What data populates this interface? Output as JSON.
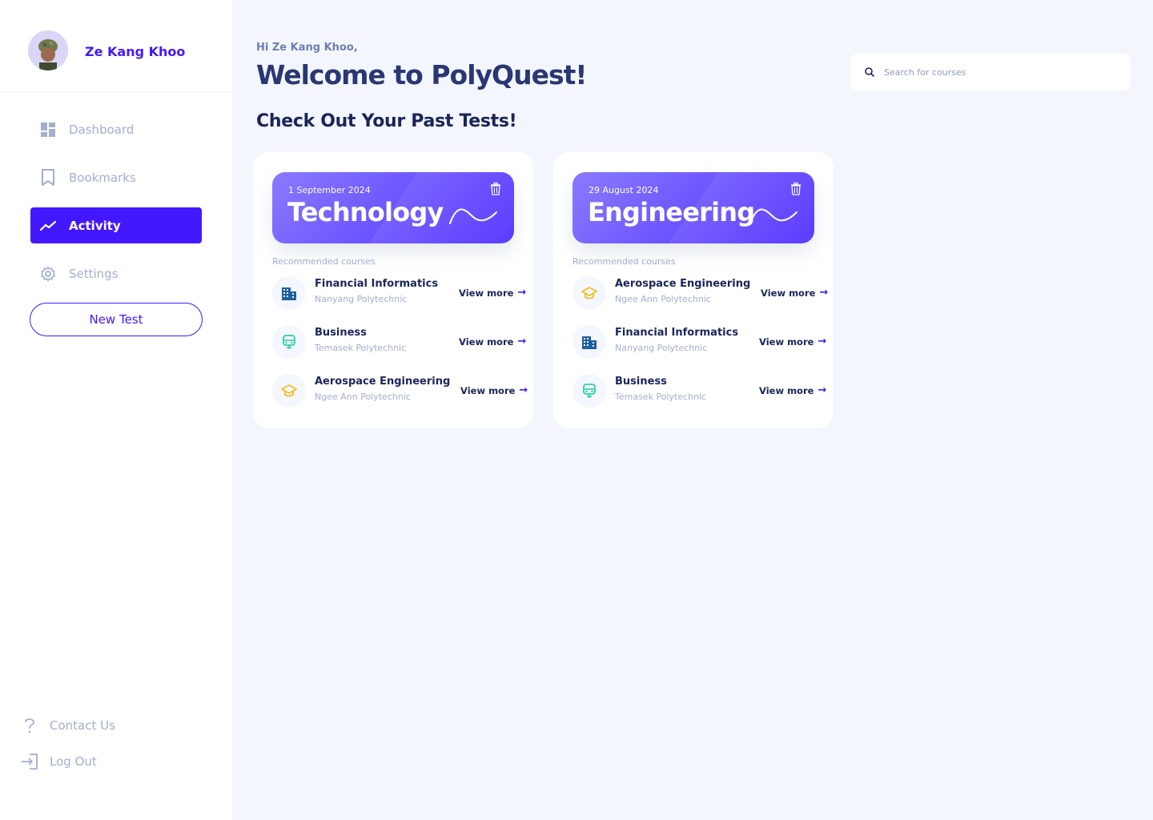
{
  "user": {
    "name": "Ze Kang Khoo"
  },
  "sidebar": {
    "items": [
      {
        "label": "Dashboard",
        "icon": "dashboard-icon"
      },
      {
        "label": "Bookmarks",
        "icon": "bookmark-icon"
      },
      {
        "label": "Activity",
        "icon": "trend-icon",
        "active": true
      },
      {
        "label": "Settings",
        "icon": "gear-icon"
      }
    ],
    "new_test_label": "New Test",
    "contact_label": "Contact Us",
    "logout_label": "Log Out"
  },
  "header": {
    "greeting": "Hi Ze Kang Khoo,",
    "title": "Welcome to PolyQuest!",
    "subtitle": "Check Out Your Past Tests!"
  },
  "search": {
    "placeholder": "Search for courses"
  },
  "tests": [
    {
      "date": "1 September 2024",
      "title": "Technology",
      "recommended_label": "Recommended courses",
      "courses": [
        {
          "name": "Financial Informatics",
          "school": "Nanyang Polytechnic",
          "icon": "building-icon",
          "action": "View more"
        },
        {
          "name": "Business",
          "school": "Temasek Polytechnic",
          "icon": "bus-icon",
          "action": "View more"
        },
        {
          "name": "Aerospace Engineering",
          "school": "Ngee Ann Polytechnic",
          "icon": "graduation-cap-icon",
          "action": "View more"
        }
      ]
    },
    {
      "date": "29 August 2024",
      "title": "Engineering",
      "recommended_label": "Recommended courses",
      "courses": [
        {
          "name": "Aerospace Engineering",
          "school": "Ngee Ann Polytechnic",
          "icon": "graduation-cap-icon",
          "action": "View more"
        },
        {
          "name": "Financial Informatics",
          "school": "Nanyang Polytechnic",
          "icon": "building-icon",
          "action": "View more"
        },
        {
          "name": "Business",
          "school": "Temasek Polytechnic",
          "icon": "bus-icon",
          "action": "View more"
        }
      ]
    }
  ],
  "colors": {
    "accent": "#4318ff",
    "title": "#2b3674",
    "muted": "#a3aed0",
    "background": "#f3f6fd",
    "building_icon": "#1f5fa0",
    "bus_icon": "#2ecfa0",
    "cap_icon": "#f5bd1f"
  }
}
